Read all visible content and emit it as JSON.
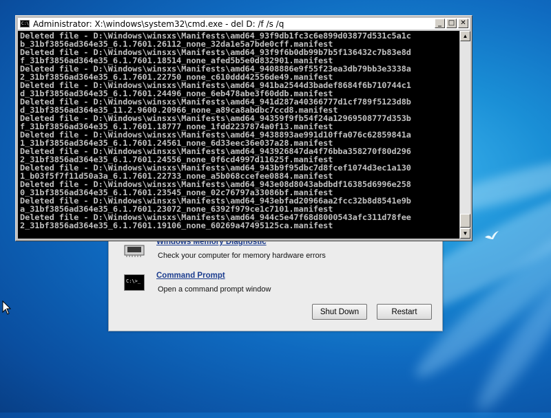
{
  "cmd_window": {
    "title": "Administrator: X:\\windows\\system32\\cmd.exe - del  D: /f /s /q",
    "icon_text": "C:\\",
    "minimize_glyph": "_",
    "maximize_glyph": "□",
    "close_glyph": "✕",
    "lines": [
      "Deleted file - D:\\Windows\\winsxs\\Manifests\\amd64_93f9db1fc3c6e899d03877d531c5a1c",
      "b_31bf3856ad364e35_6.1.7601.26112_none_32da1e5a7bde0cff.manifest",
      "Deleted file - D:\\Windows\\winsxs\\Manifests\\amd64_93f9f6b0db99b7b5f136432c7b83e8d",
      "f_31bf3856ad364e35_6.1.7601.18514_none_afed5b5e0d832901.manifest",
      "Deleted file - D:\\Windows\\winsxs\\Manifests\\amd64_9408886e9f55f23ea3db79bb3e3338a",
      "2_31bf3856ad364e35_6.1.7601.22750_none_c610ddd42556de49.manifest",
      "Deleted file - D:\\Windows\\winsxs\\Manifests\\amd64_941ba2544d3badef8684f6b710744c1",
      "d_31bf3856ad364e35_6.1.7601.24496_none_6eb478abe3f60ddb.manifest",
      "Deleted file - D:\\Windows\\winsxs\\Manifests\\amd64_941d287a40366777d1cf789f5123d8b",
      "d_31bf3856ad364e35_11.2.9600.20966_none_a89ca8abdbc7ccd8.manifest",
      "Deleted file - D:\\Windows\\winsxs\\Manifests\\amd64_94359f9fb54f24a12969508777d353b",
      "f_31bf3856ad364e35_6.1.7601.18777_none_1fdd2237874a0f13.manifest",
      "Deleted file - D:\\Windows\\winsxs\\Manifests\\amd64_9438893ae991d10ffa076c62859841a",
      "1_31bf3856ad364e35_6.1.7601.24561_none_6d33eec36e037a28.manifest",
      "Deleted file - D:\\Windows\\winsxs\\Manifests\\amd64_943926847da4f76bba358270f80d296",
      "2_31bf3856ad364e35_6.1.7601.24556_none_0f6cd4997d11625f.manifest",
      "Deleted file - D:\\Windows\\winsxs\\Manifests\\amd64_943b9f95dbc7d8fcef1074d3ec1a130",
      "1_b03f5f7f11d50a3a_6.1.7601.22733_none_a5b068ccefee0884.manifest",
      "Deleted file - D:\\Windows\\winsxs\\Manifests\\amd64_943e08d8043abdbdf16385d6996e258",
      "0_31bf3856ad364e35_6.1.7601.23545_none_02c76797a33086bf.manifest",
      "Deleted file - D:\\Windows\\winsxs\\Manifests\\amd64_943ebfad20966aa2fcc32b8d8541e9b",
      "a_31bf3856ad364e35_6.1.7601.23072_none_6392f979ce1c7101.manifest",
      "Deleted file - D:\\Windows\\winsxs\\Manifests\\amd64_944c5e47f68d8000543afc311d78fee",
      "2_31bf3856ad364e35_6.1.7601.19106_none_60269a47495125ca.manifest"
    ]
  },
  "recovery_dialog": {
    "options": [
      {
        "title": "Windows Memory Diagnostic",
        "description": "Check your computer for memory hardware errors",
        "icon": "memory-chip-icon"
      },
      {
        "title": "Command Prompt",
        "description": "Open a command prompt window",
        "icon": "command-prompt-icon"
      }
    ],
    "cmd_icon_text": "C:\\>_",
    "shutdown_label": "Shut Down",
    "restart_label": "Restart"
  },
  "colors": {
    "console_bg": "#000000",
    "console_text": "#c0c0c0",
    "link": "#1c3d8f",
    "desktop_blue": "#0f6ac0"
  }
}
